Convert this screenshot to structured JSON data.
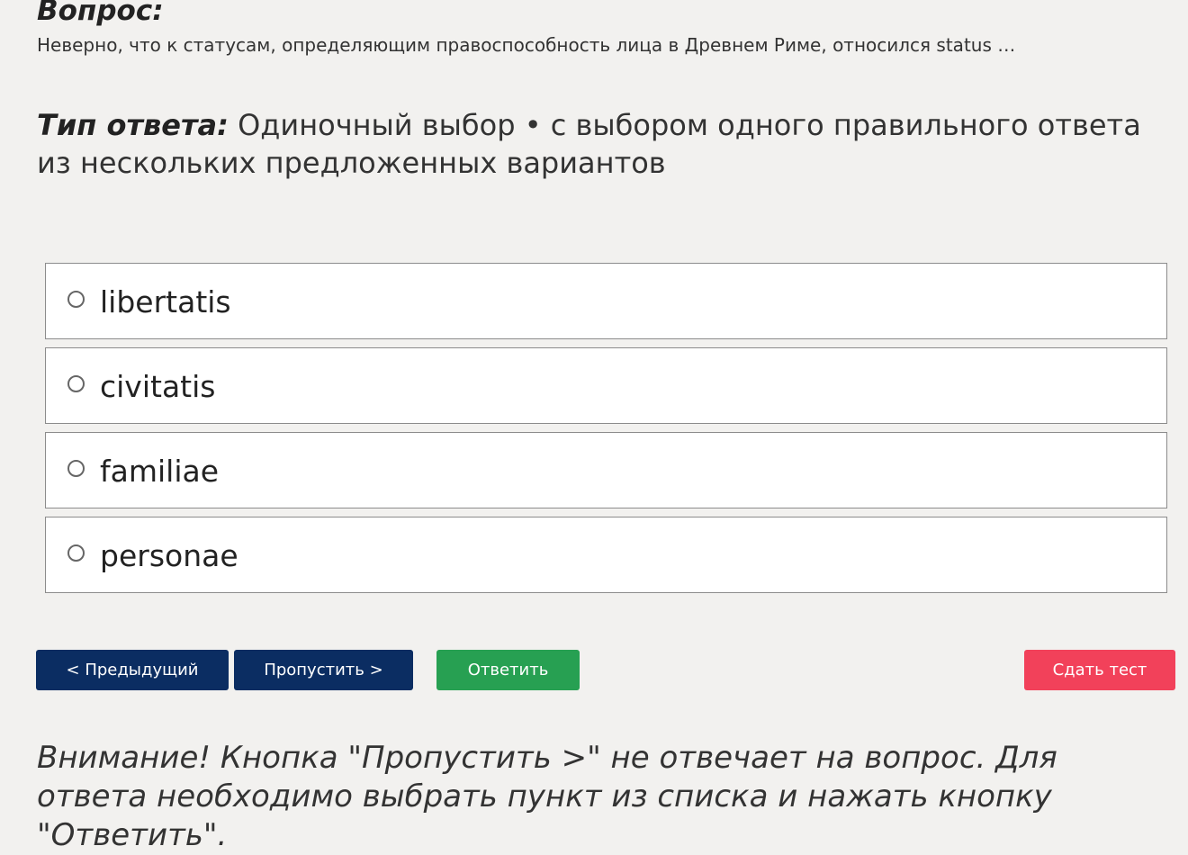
{
  "question": {
    "heading": "Вопрос:",
    "text": "Неверно, что к статусам, определяющим правоспособность лица в Древнем Риме, относился status …"
  },
  "answer_type": {
    "label": "Тип ответа:",
    "value": "Одиночный выбор • с выбором одного правильного ответа из нескольких предложенных вариантов"
  },
  "options": [
    {
      "label": "libertatis",
      "selected": false
    },
    {
      "label": "civitatis",
      "selected": false
    },
    {
      "label": "familiae",
      "selected": false
    },
    {
      "label": "personae",
      "selected": false
    }
  ],
  "buttons": {
    "prev": "< Предыдущий",
    "skip": "Пропустить >",
    "answer": "Ответить",
    "submit": "Сдать тест"
  },
  "colors": {
    "nav_button": "#0b2d62",
    "answer_button": "#27a052",
    "submit_button": "#f2415a",
    "background": "#f2f1ef"
  },
  "warning": "Внимание! Кнопка \"Пропустить >\" не отвечает на вопрос. Для ответа необходимо выбрать пункт из списка и нажать кнопку \"Ответить\"."
}
